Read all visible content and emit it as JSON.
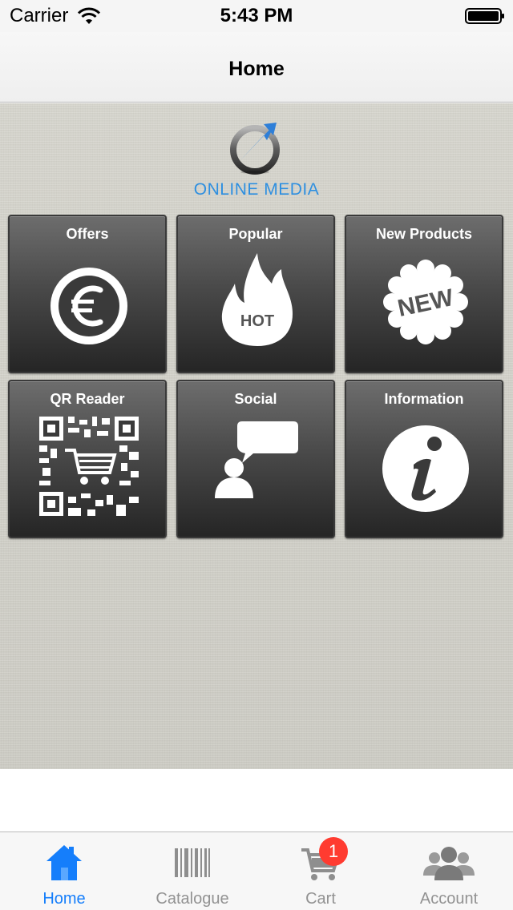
{
  "status_bar": {
    "carrier": "Carrier",
    "time": "5:43 PM"
  },
  "nav": {
    "title": "Home"
  },
  "brand": {
    "name": "ONLINE MEDIA"
  },
  "tiles": [
    {
      "label": "Offers",
      "icon": "euro-coin-icon"
    },
    {
      "label": "Popular",
      "icon": "flame-hot-icon",
      "icon_text": "HOT"
    },
    {
      "label": "New Products",
      "icon": "new-badge-icon",
      "icon_text": "NEW"
    },
    {
      "label": "QR Reader",
      "icon": "qr-code-icon"
    },
    {
      "label": "Social",
      "icon": "chat-person-icon"
    },
    {
      "label": "Information",
      "icon": "info-icon"
    }
  ],
  "tab_bar": {
    "items": [
      {
        "label": "Home",
        "icon": "home-icon",
        "active": true
      },
      {
        "label": "Catalogue",
        "icon": "barcode-icon"
      },
      {
        "label": "Cart",
        "icon": "cart-icon",
        "badge": "1"
      },
      {
        "label": "Account",
        "icon": "users-icon"
      }
    ]
  },
  "colors": {
    "accent": "#157efb",
    "brand_blue": "#2e8fe0",
    "badge_red": "#ff3b30",
    "inactive": "#929292"
  }
}
